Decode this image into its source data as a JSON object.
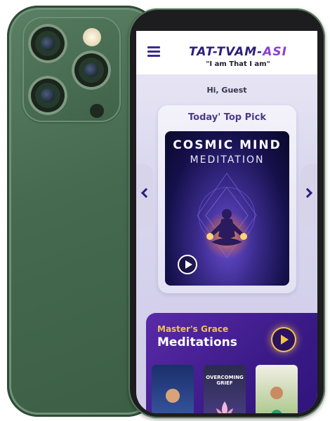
{
  "header": {
    "brand_main": "TAT-TVAM-",
    "brand_accent": "ASI",
    "tagline": "\"I am That I am\""
  },
  "greeting": "Hi, Guest",
  "top_pick": {
    "heading": "Today' Top Pick",
    "poster_title": "COSMIC MIND",
    "poster_subtitle": "MEDITATION"
  },
  "masters": {
    "kicker": "Master's Grace",
    "title": "Meditations",
    "thumbnails": [
      {
        "label": ""
      },
      {
        "label": "OVERCOMING GRIEF"
      },
      {
        "label": ""
      }
    ]
  },
  "colors": {
    "brand": "#2c1e7a",
    "accent_purple": "#8b3fd1",
    "gold": "#f2c14e",
    "phone_green": "#4a6f53"
  }
}
